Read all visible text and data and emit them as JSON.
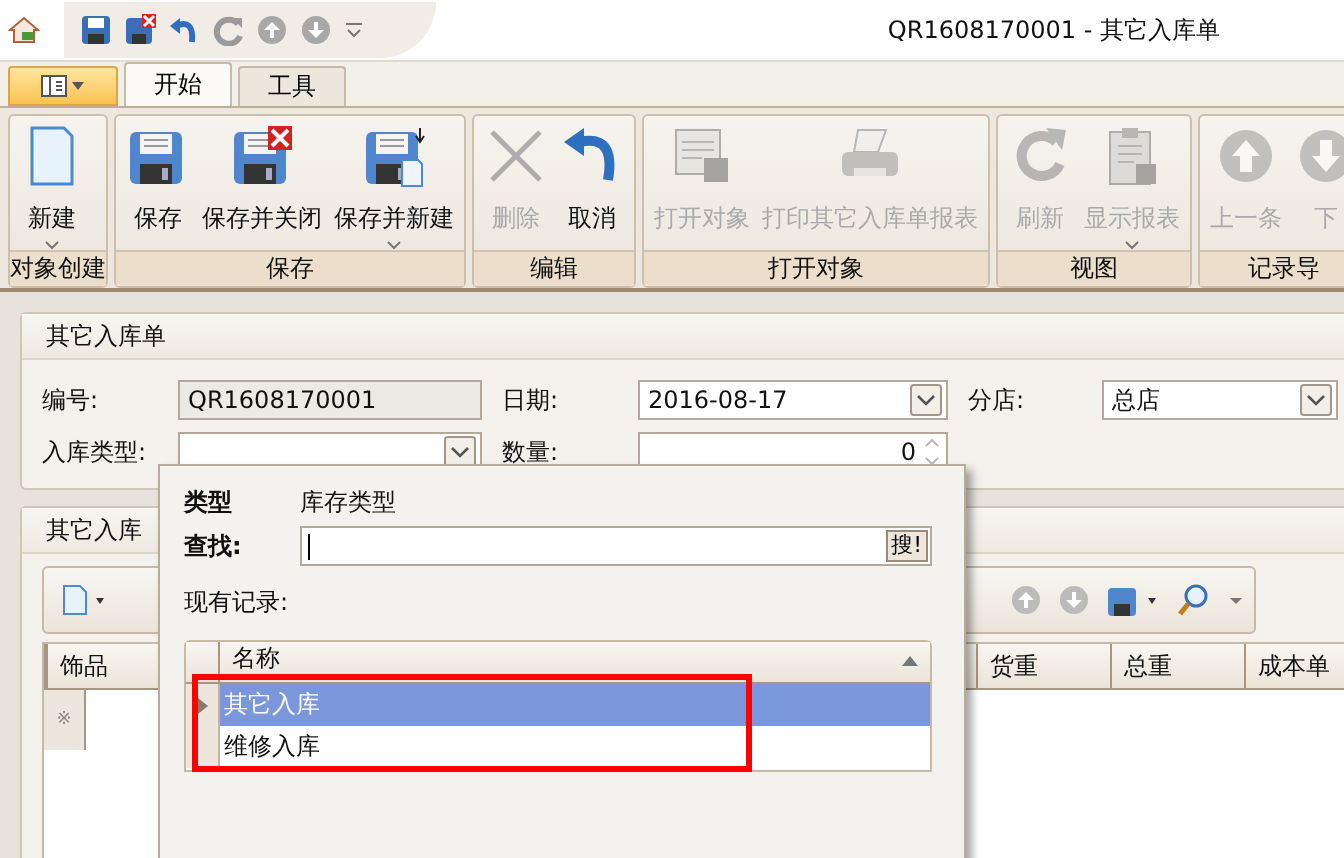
{
  "title_bar": {
    "title": "QR1608170001 - 其它入库单"
  },
  "ribbon_tabs": [
    {
      "label": "开始",
      "selected": true
    },
    {
      "label": "工具",
      "selected": false
    }
  ],
  "ribbon_groups": [
    {
      "label": "对象创建",
      "buttons": [
        {
          "label": "新建",
          "kind": "new",
          "disabled": false,
          "has_menu": true
        }
      ]
    },
    {
      "label": "保存",
      "buttons": [
        {
          "label": "保存",
          "kind": "save",
          "disabled": false,
          "has_menu": false
        },
        {
          "label": "保存并关闭",
          "kind": "save-close",
          "disabled": false,
          "has_menu": false
        },
        {
          "label": "保存并新建",
          "kind": "save-new",
          "disabled": false,
          "has_menu": true
        }
      ]
    },
    {
      "label": "编辑",
      "buttons": [
        {
          "label": "删除",
          "kind": "delete",
          "disabled": true,
          "has_menu": false
        },
        {
          "label": "取消",
          "kind": "cancel",
          "disabled": false,
          "has_menu": false
        }
      ]
    },
    {
      "label": "打开对象",
      "buttons": [
        {
          "label": "打开对象",
          "kind": "open",
          "disabled": true,
          "has_menu": false
        },
        {
          "label": "打印其它入库单报表",
          "kind": "print",
          "disabled": true,
          "has_menu": false
        }
      ]
    },
    {
      "label": "视图",
      "buttons": [
        {
          "label": "刷新",
          "kind": "refresh",
          "disabled": true,
          "has_menu": false
        },
        {
          "label": "显示报表",
          "kind": "report",
          "disabled": true,
          "has_menu": true
        }
      ]
    },
    {
      "label": "记录导",
      "buttons": [
        {
          "label": "上一条",
          "kind": "prev",
          "disabled": true,
          "has_menu": false
        },
        {
          "label": "下",
          "kind": "next",
          "disabled": true,
          "has_menu": false
        }
      ]
    }
  ],
  "form_panel": {
    "title": "其它入库单",
    "fields": [
      {
        "label": "编号:",
        "value": "QR1608170001",
        "kind": "readonly"
      },
      {
        "label": "日期:",
        "value": "2016-08-17",
        "kind": "combo"
      },
      {
        "label": "分店:",
        "value": "总店",
        "kind": "combo"
      },
      {
        "label": "入库类型:",
        "kind": "combo"
      },
      {
        "label": "数量:",
        "value": "0",
        "kind": "spin"
      }
    ]
  },
  "detail_panel": {
    "title": "其它入库",
    "left_columns": [
      "饰品"
    ],
    "right_columns": [
      "货重",
      "总重",
      "成本单"
    ],
    "new_row_marker": "※"
  },
  "lookup_popup": {
    "type_label": "类型",
    "type_value": "库存类型",
    "search_label": "查找:",
    "search_button": "搜!",
    "records_label": "现有记录:",
    "column": "名称",
    "rows": [
      {
        "name": "其它入库",
        "selected": true
      },
      {
        "name": "维修入库",
        "selected": false
      }
    ]
  }
}
